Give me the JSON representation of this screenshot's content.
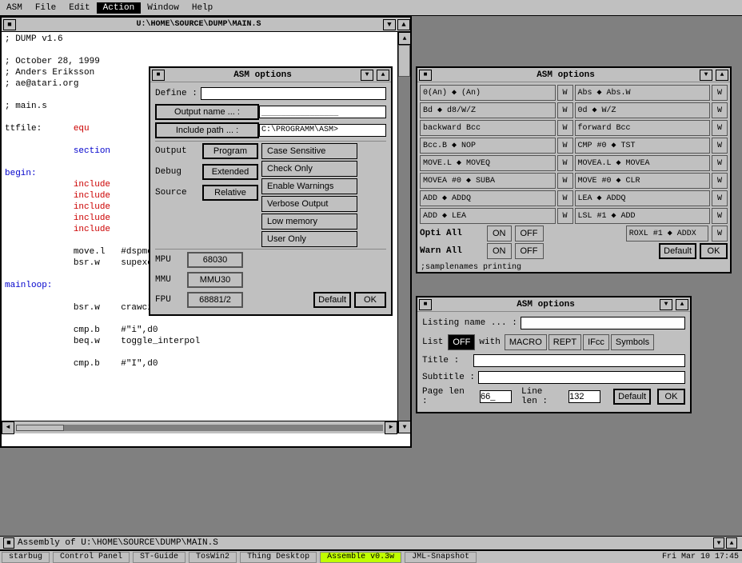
{
  "menubar": {
    "items": [
      "ASM",
      "File",
      "Edit",
      "Action",
      "Window",
      "Help"
    ]
  },
  "code_window": {
    "title": "U:\\HOME\\SOURCE\\DUMP\\MAIN.S",
    "lines": [
      "; DUMP v1.6",
      "",
      "; October 28, 1999",
      "; Anders Eriksson",
      "; ae@atari.org",
      "",
      "; main.s",
      "",
      "ttfile:      equ",
      "",
      "             section",
      "",
      "begin:",
      "             include",
      "             include",
      "             include",
      "             include",
      "             include",
      "",
      "             move.l   #dspmod_begin,super_rout",
      "             bsr.w    supexec",
      "",
      "mainloop:",
      "",
      "             bsr.w    crawcin",
      "",
      "             cmp.b    #\"i\",d0",
      "             beq.w    toggle_interpol",
      "",
      "             cmp.b    #\"I\",d0"
    ]
  },
  "asm_dialog_1": {
    "title": "ASM options",
    "define_label": "Define :",
    "define_value": "",
    "output_name_label": "Output name ... :",
    "output_name_value": "________________",
    "include_path_label": "Include path ... :",
    "include_path_value": "C:\\PROGRAMM\\ASM>",
    "output_label": "Output",
    "output_btn": "Program",
    "debug_label": "Debug",
    "debug_btn": "Extended",
    "source_label": "Source",
    "source_btn": "Relative",
    "options": [
      "Case Sensitive",
      "Check Only",
      "Enable Warnings",
      "Verbose Output",
      "Low memory",
      "User Only"
    ],
    "mpu_label": "MPU",
    "mpu_value": "68030",
    "mmu_label": "MMU",
    "mmu_value": "MMU30",
    "fpu_label": "FPU",
    "fpu_value": "68881/2",
    "default_btn": "Default",
    "ok_btn": "OK"
  },
  "asm_dialog_2": {
    "title": "ASM options",
    "cells": [
      {
        "left": "0(An) ◆ (An)",
        "right": "Abs ◆ Abs.W"
      },
      {
        "left": "Bd ◆ d8/W/Z",
        "right": "0d ◆ W/Z"
      },
      {
        "left": "backward Bcc",
        "right": "forward Bcc"
      },
      {
        "left": "Bcc.B ◆ NOP",
        "right": "CMP #0 ◆ TST"
      },
      {
        "left": "MOVE.L ◆ MOVEQ",
        "right": "MOVEA.L ◆ MOVEA"
      },
      {
        "left": "MOVEA #0 ◆ SUBA",
        "right": "MOVE #0 ◆ CLR"
      },
      {
        "left": "ADD ◆ ADDQ",
        "right": "LEA ◆ ADDQ"
      },
      {
        "left": "ADD ◆ LEA",
        "right": "LSL #1 ◆ ADD"
      },
      {
        "left": "ROXL #1 ◆ ADDX",
        "right": ""
      },
      {
        "left": "",
        "right": ""
      }
    ],
    "opti_all_label": "Opti All",
    "warn_all_label": "Warn All",
    "on_label": "ON",
    "off_label": "OFF",
    "default_btn": "Default",
    "ok_btn": "OK"
  },
  "asm_dialog_3": {
    "title": "ASM options",
    "listing_name_label": "Listing name ... :",
    "listing_name_value": "",
    "list_label": "List",
    "list_off": "OFF",
    "list_with": "with",
    "macro_btn": "MACRO",
    "rept_btn": "REPT",
    "ifcc_btn": "IFcc",
    "symbols_btn": "Symbols",
    "title_label": "Title :",
    "title_value": "",
    "subtitle_label": "Subtitle :",
    "subtitle_value": "",
    "page_len_label": "Page len :",
    "page_len_value": "66_",
    "line_len_label": "Line len :",
    "line_len_value": "132",
    "default_btn": "Default",
    "ok_btn": "OK"
  },
  "assembly_bar": {
    "text": "Assembly of U:\\HOME\\SOURCE\\DUMP\\MAIN.S"
  },
  "taskbar": {
    "items": [
      "starbug",
      "Control Panel",
      "ST-Guide",
      "TosWin2",
      "Thing Desktop",
      "Assemble v0.3w",
      "JML-Snapshot"
    ],
    "active_index": 5,
    "time": "Fri Mar 10 17:45"
  },
  "scrollbar": {
    "up_arrow": "▲",
    "down_arrow": "▼",
    "left_arrow": "◄",
    "right_arrow": "►"
  }
}
